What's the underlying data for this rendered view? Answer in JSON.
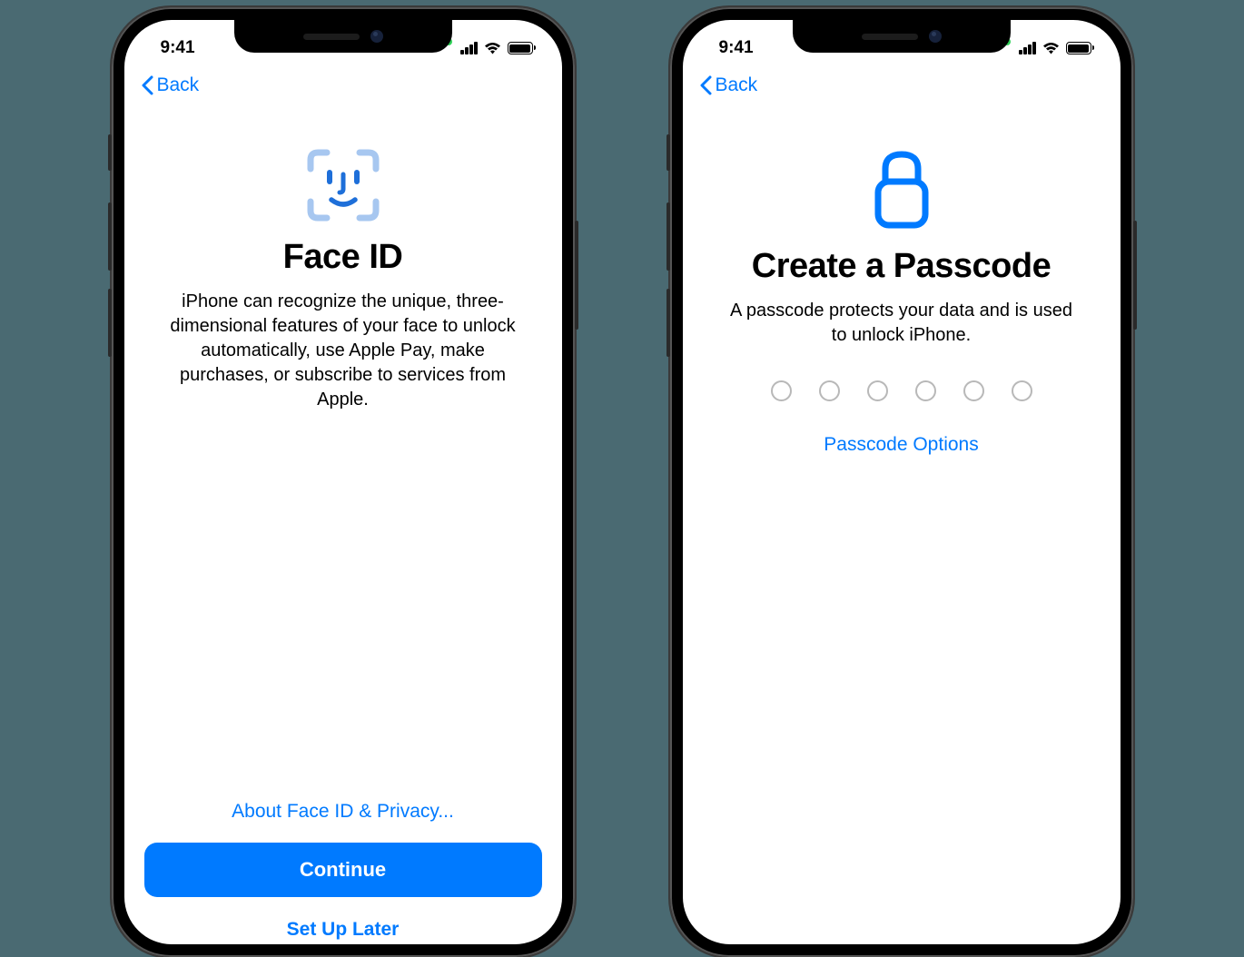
{
  "statusBar": {
    "time": "9:41"
  },
  "nav": {
    "backLabel": "Back"
  },
  "left": {
    "title": "Face ID",
    "body": "iPhone can recognize the unique, three-dimensional features of your face to unlock automatically, use Apple Pay, make purchases, or subscribe to services from Apple.",
    "aboutLink": "About Face ID & Privacy...",
    "continueLabel": "Continue",
    "setupLaterLabel": "Set Up Later"
  },
  "right": {
    "title": "Create a Passcode",
    "body": "A passcode protects your data and is used to unlock iPhone.",
    "passcodeOptions": "Passcode Options",
    "digitCount": 6
  }
}
